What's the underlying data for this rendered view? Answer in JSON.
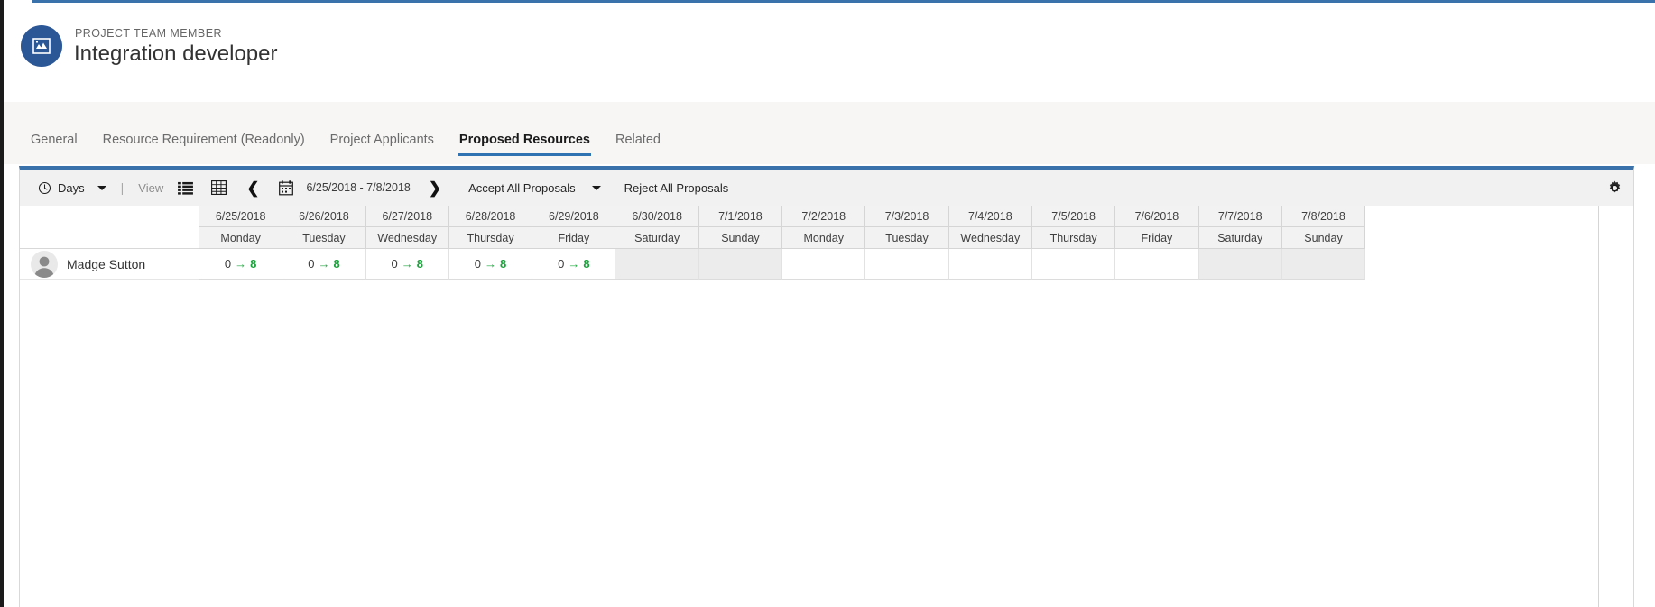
{
  "header": {
    "entity_type": "PROJECT TEAM MEMBER",
    "entity_name": "Integration developer",
    "icon": "project-team-member-icon",
    "icon_color": "#2b5797"
  },
  "tabs": [
    {
      "label": "General",
      "active": false
    },
    {
      "label": "Resource Requirement (Readonly)",
      "active": false
    },
    {
      "label": "Project Applicants",
      "active": false
    },
    {
      "label": "Proposed Resources",
      "active": true
    },
    {
      "label": "Related",
      "active": false
    }
  ],
  "toolbar": {
    "scale_icon": "clock-icon",
    "scale_label": "Days",
    "scale_caret": "chevron-down-icon",
    "separator": "|",
    "view_label": "View",
    "list_view_icon": "list-view-icon",
    "grid_view_icon": "grid-view-icon",
    "prev_icon": "chevron-left-icon",
    "calendar_icon": "calendar-icon",
    "date_range": "6/25/2018 - 7/8/2018",
    "next_icon": "chevron-right-icon",
    "accept_all_label": "Accept All Proposals",
    "accept_all_caret": "chevron-down-icon",
    "reject_all_label": "Reject All Proposals",
    "settings_icon": "gear-icon"
  },
  "grid": {
    "resource_header": "",
    "columns": [
      {
        "date": "6/25/2018",
        "day": "Monday",
        "weekend": false
      },
      {
        "date": "6/26/2018",
        "day": "Tuesday",
        "weekend": false
      },
      {
        "date": "6/27/2018",
        "day": "Wednesday",
        "weekend": false
      },
      {
        "date": "6/28/2018",
        "day": "Thursday",
        "weekend": false
      },
      {
        "date": "6/29/2018",
        "day": "Friday",
        "weekend": false
      },
      {
        "date": "6/30/2018",
        "day": "Saturday",
        "weekend": true
      },
      {
        "date": "7/1/2018",
        "day": "Sunday",
        "weekend": true
      },
      {
        "date": "7/2/2018",
        "day": "Monday",
        "weekend": false
      },
      {
        "date": "7/3/2018",
        "day": "Tuesday",
        "weekend": false
      },
      {
        "date": "7/4/2018",
        "day": "Wednesday",
        "weekend": false
      },
      {
        "date": "7/5/2018",
        "day": "Thursday",
        "weekend": false
      },
      {
        "date": "7/6/2018",
        "day": "Friday",
        "weekend": false
      },
      {
        "date": "7/7/2018",
        "day": "Saturday",
        "weekend": true
      },
      {
        "date": "7/8/2018",
        "day": "Sunday",
        "weekend": true
      }
    ],
    "rows": [
      {
        "name": "Madge Sutton",
        "avatar": "person-avatar",
        "cells": [
          {
            "from": "0",
            "arrow": "→",
            "to": "8"
          },
          {
            "from": "0",
            "arrow": "→",
            "to": "8"
          },
          {
            "from": "0",
            "arrow": "→",
            "to": "8"
          },
          {
            "from": "0",
            "arrow": "→",
            "to": "8"
          },
          {
            "from": "0",
            "arrow": "→",
            "to": "8"
          },
          {
            "from": "",
            "arrow": "",
            "to": ""
          },
          {
            "from": "",
            "arrow": "",
            "to": ""
          },
          {
            "from": "",
            "arrow": "",
            "to": ""
          },
          {
            "from": "",
            "arrow": "",
            "to": ""
          },
          {
            "from": "",
            "arrow": "",
            "to": ""
          },
          {
            "from": "",
            "arrow": "",
            "to": ""
          },
          {
            "from": "",
            "arrow": "",
            "to": ""
          },
          {
            "from": "",
            "arrow": "",
            "to": ""
          },
          {
            "from": "",
            "arrow": "",
            "to": ""
          }
        ]
      }
    ]
  },
  "colors": {
    "accent": "#2f73b3",
    "panel_top_rule": "#3a72ab",
    "proposal_green": "#18a33a",
    "entity_badge": "#2b5797"
  }
}
